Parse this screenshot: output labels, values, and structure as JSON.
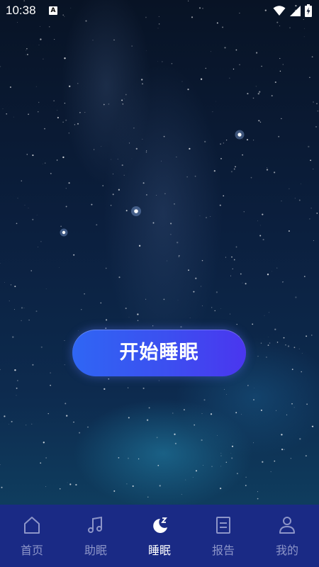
{
  "status_bar": {
    "time": "10:38",
    "notification_icon": "A",
    "icons": [
      "wifi-icon",
      "cellular-signal-icon",
      "battery-charging-icon"
    ]
  },
  "main": {
    "start_sleep_label": "开始睡眠"
  },
  "tab_bar": {
    "active_tab": "睡眠",
    "tabs": [
      {
        "label": "首页",
        "icon": "home-icon"
      },
      {
        "label": "助眠",
        "icon": "music-note-icon"
      },
      {
        "label": "睡眠",
        "icon": "moon-zzz-icon"
      },
      {
        "label": "报告",
        "icon": "report-document-icon"
      },
      {
        "label": "我的",
        "icon": "user-profile-icon"
      }
    ]
  },
  "colors": {
    "tab_bar_background": "#1a2a85",
    "tab_active": "#ffffff",
    "tab_inactive": "#8d95c8",
    "button_gradient_start": "#2f66f4",
    "button_gradient_end": "#4a36ef"
  }
}
